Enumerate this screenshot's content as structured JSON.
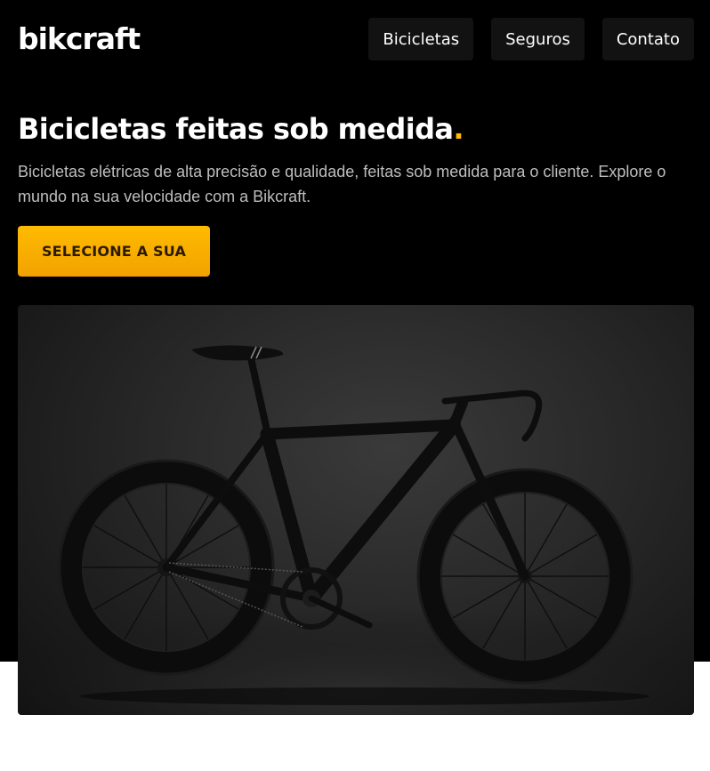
{
  "brand": {
    "logo": "bikcraft"
  },
  "nav": {
    "items": [
      {
        "label": "Bicicletas"
      },
      {
        "label": "Seguros"
      },
      {
        "label": "Contato"
      }
    ]
  },
  "hero": {
    "title": "Bicicletas feitas sob medida",
    "title_accent": ".",
    "description": "Bicicletas elétricas de alta precisão e qualidade, feitas sob medida para o cliente. Explore o mundo na sua velocidade com a Bikcraft.",
    "cta_label": "SELECIONE A SUA"
  },
  "colors": {
    "accent": "#FFBB00",
    "background_dark": "#000000",
    "nav_bg": "#121212"
  }
}
